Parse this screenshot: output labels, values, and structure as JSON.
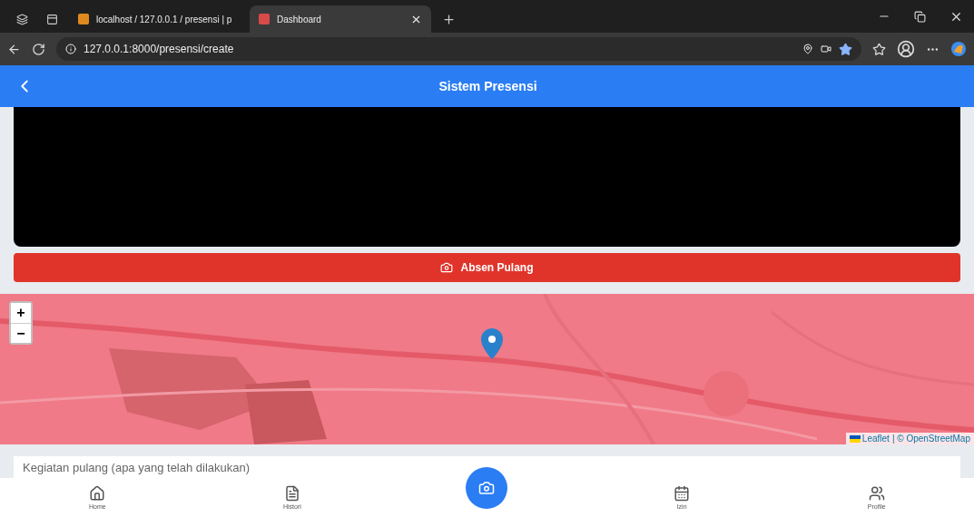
{
  "browser": {
    "tabs": [
      {
        "title": "localhost / 127.0.0.1 / presensi | p",
        "selected": false
      },
      {
        "title": "Dashboard",
        "selected": true
      }
    ],
    "address": "127.0.0.1:8000/presensi/create"
  },
  "header": {
    "title": "Sistem Presensi"
  },
  "action_button": {
    "label": "Absen Pulang"
  },
  "map": {
    "zoom_in": "+",
    "zoom_out": "−",
    "attribution_link": "Leaflet",
    "attribution_text": "| © OpenStreetMap"
  },
  "activity_field": {
    "placeholder": "Kegiatan pulang (apa yang telah dilakukan)"
  },
  "bottom_nav": [
    {
      "kind": "home",
      "label": "Home"
    },
    {
      "kind": "history",
      "label": "Histori"
    },
    {
      "kind": "camera"
    },
    {
      "kind": "calendar",
      "label": "Izin"
    },
    {
      "kind": "profile",
      "label": "Profile"
    }
  ]
}
